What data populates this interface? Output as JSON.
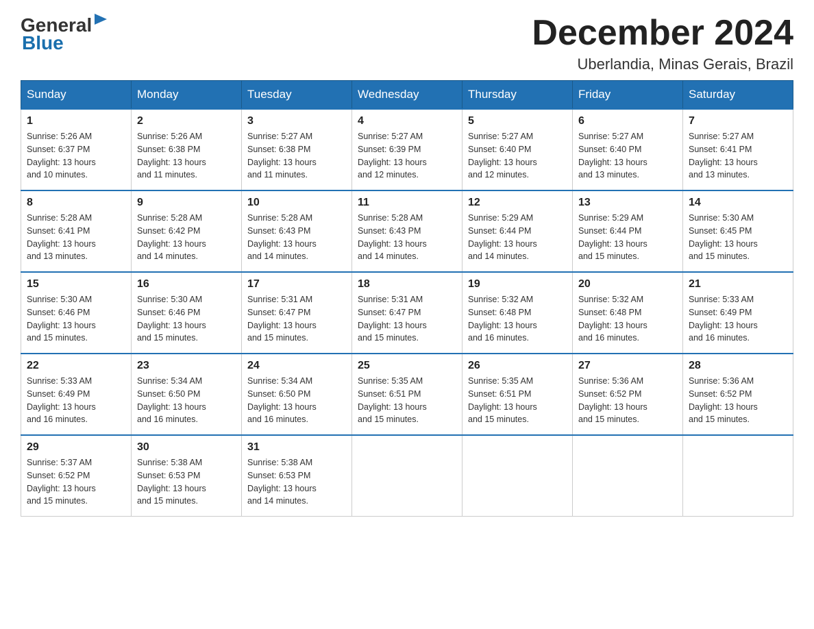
{
  "header": {
    "logo_general": "General",
    "logo_blue": "Blue",
    "month_title": "December 2024",
    "location": "Uberlandia, Minas Gerais, Brazil"
  },
  "days_of_week": [
    "Sunday",
    "Monday",
    "Tuesday",
    "Wednesday",
    "Thursday",
    "Friday",
    "Saturday"
  ],
  "weeks": [
    [
      {
        "day": "1",
        "sunrise": "5:26 AM",
        "sunset": "6:37 PM",
        "daylight": "13 hours and 10 minutes."
      },
      {
        "day": "2",
        "sunrise": "5:26 AM",
        "sunset": "6:38 PM",
        "daylight": "13 hours and 11 minutes."
      },
      {
        "day": "3",
        "sunrise": "5:27 AM",
        "sunset": "6:38 PM",
        "daylight": "13 hours and 11 minutes."
      },
      {
        "day": "4",
        "sunrise": "5:27 AM",
        "sunset": "6:39 PM",
        "daylight": "13 hours and 12 minutes."
      },
      {
        "day": "5",
        "sunrise": "5:27 AM",
        "sunset": "6:40 PM",
        "daylight": "13 hours and 12 minutes."
      },
      {
        "day": "6",
        "sunrise": "5:27 AM",
        "sunset": "6:40 PM",
        "daylight": "13 hours and 13 minutes."
      },
      {
        "day": "7",
        "sunrise": "5:27 AM",
        "sunset": "6:41 PM",
        "daylight": "13 hours and 13 minutes."
      }
    ],
    [
      {
        "day": "8",
        "sunrise": "5:28 AM",
        "sunset": "6:41 PM",
        "daylight": "13 hours and 13 minutes."
      },
      {
        "day": "9",
        "sunrise": "5:28 AM",
        "sunset": "6:42 PM",
        "daylight": "13 hours and 14 minutes."
      },
      {
        "day": "10",
        "sunrise": "5:28 AM",
        "sunset": "6:43 PM",
        "daylight": "13 hours and 14 minutes."
      },
      {
        "day": "11",
        "sunrise": "5:28 AM",
        "sunset": "6:43 PM",
        "daylight": "13 hours and 14 minutes."
      },
      {
        "day": "12",
        "sunrise": "5:29 AM",
        "sunset": "6:44 PM",
        "daylight": "13 hours and 14 minutes."
      },
      {
        "day": "13",
        "sunrise": "5:29 AM",
        "sunset": "6:44 PM",
        "daylight": "13 hours and 15 minutes."
      },
      {
        "day": "14",
        "sunrise": "5:30 AM",
        "sunset": "6:45 PM",
        "daylight": "13 hours and 15 minutes."
      }
    ],
    [
      {
        "day": "15",
        "sunrise": "5:30 AM",
        "sunset": "6:46 PM",
        "daylight": "13 hours and 15 minutes."
      },
      {
        "day": "16",
        "sunrise": "5:30 AM",
        "sunset": "6:46 PM",
        "daylight": "13 hours and 15 minutes."
      },
      {
        "day": "17",
        "sunrise": "5:31 AM",
        "sunset": "6:47 PM",
        "daylight": "13 hours and 15 minutes."
      },
      {
        "day": "18",
        "sunrise": "5:31 AM",
        "sunset": "6:47 PM",
        "daylight": "13 hours and 15 minutes."
      },
      {
        "day": "19",
        "sunrise": "5:32 AM",
        "sunset": "6:48 PM",
        "daylight": "13 hours and 16 minutes."
      },
      {
        "day": "20",
        "sunrise": "5:32 AM",
        "sunset": "6:48 PM",
        "daylight": "13 hours and 16 minutes."
      },
      {
        "day": "21",
        "sunrise": "5:33 AM",
        "sunset": "6:49 PM",
        "daylight": "13 hours and 16 minutes."
      }
    ],
    [
      {
        "day": "22",
        "sunrise": "5:33 AM",
        "sunset": "6:49 PM",
        "daylight": "13 hours and 16 minutes."
      },
      {
        "day": "23",
        "sunrise": "5:34 AM",
        "sunset": "6:50 PM",
        "daylight": "13 hours and 16 minutes."
      },
      {
        "day": "24",
        "sunrise": "5:34 AM",
        "sunset": "6:50 PM",
        "daylight": "13 hours and 16 minutes."
      },
      {
        "day": "25",
        "sunrise": "5:35 AM",
        "sunset": "6:51 PM",
        "daylight": "13 hours and 15 minutes."
      },
      {
        "day": "26",
        "sunrise": "5:35 AM",
        "sunset": "6:51 PM",
        "daylight": "13 hours and 15 minutes."
      },
      {
        "day": "27",
        "sunrise": "5:36 AM",
        "sunset": "6:52 PM",
        "daylight": "13 hours and 15 minutes."
      },
      {
        "day": "28",
        "sunrise": "5:36 AM",
        "sunset": "6:52 PM",
        "daylight": "13 hours and 15 minutes."
      }
    ],
    [
      {
        "day": "29",
        "sunrise": "5:37 AM",
        "sunset": "6:52 PM",
        "daylight": "13 hours and 15 minutes."
      },
      {
        "day": "30",
        "sunrise": "5:38 AM",
        "sunset": "6:53 PM",
        "daylight": "13 hours and 15 minutes."
      },
      {
        "day": "31",
        "sunrise": "5:38 AM",
        "sunset": "6:53 PM",
        "daylight": "13 hours and 14 minutes."
      },
      null,
      null,
      null,
      null
    ]
  ],
  "labels": {
    "sunrise": "Sunrise:",
    "sunset": "Sunset:",
    "daylight": "Daylight:"
  }
}
